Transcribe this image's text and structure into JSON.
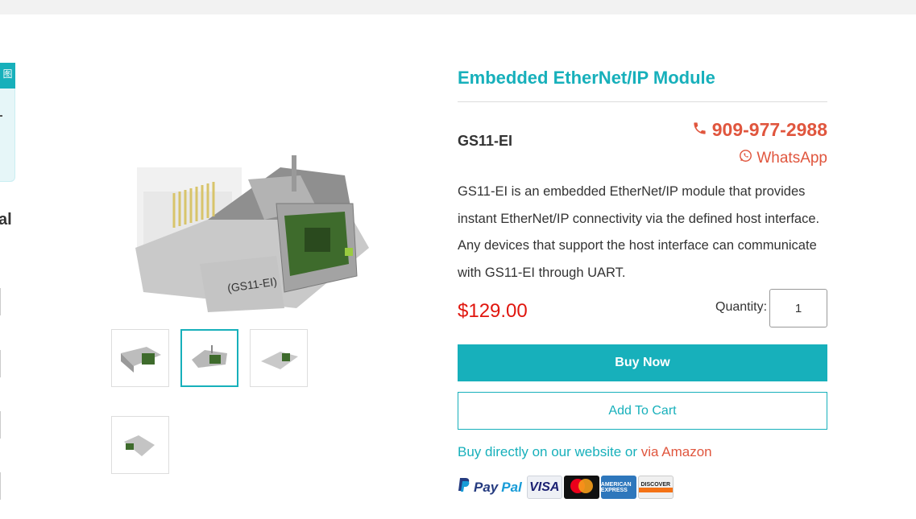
{
  "sidebar_partial": {
    "badge_glyph": "图",
    "heading_fragment": "al"
  },
  "product": {
    "title": "Embedded EtherNet/IP Module",
    "sku": "GS11-EI",
    "phone": "909-977-2988",
    "whatsapp_label": "WhatsApp",
    "description": "GS11-EI is an embedded EtherNet/IP module that provides instant EtherNet/IP connectivity via the defined host interface. Any devices that support the host interface can communicate with GS11-EI through UART.",
    "price": "$129.00",
    "quantity_label": "Quantity:",
    "quantity_value": "1",
    "buy_now_label": "Buy Now",
    "add_to_cart_label": "Add To Cart",
    "buy_direct_text": "Buy directly on our website or ",
    "amazon_link_text": "via Amazon"
  },
  "gallery": {
    "thumbnail_count": 4,
    "active_index": 1
  },
  "payments": {
    "paypal_pay": "Pay",
    "paypal_pal": "Pal",
    "visa": "VISA",
    "amex": "AMERICAN EXPRESS",
    "discover": "DISCOVER"
  },
  "colors": {
    "accent": "#17b0bb",
    "phone": "#e0563e",
    "price": "#e0160e"
  }
}
